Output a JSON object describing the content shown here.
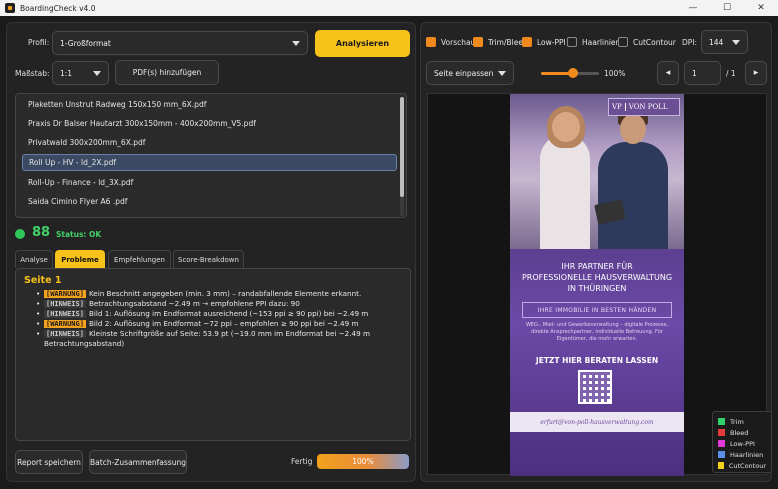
{
  "window": {
    "title": "BoardingCheck v4.0",
    "minimize": "—",
    "maximize": "☐",
    "close": "✕"
  },
  "left": {
    "profile_label": "Profil:",
    "profile_value": "1-Großformat",
    "analyze_label": "Analysieren",
    "scale_label": "Maßstab:",
    "scale_value": "1:1",
    "add_pdf_label": "PDF(s) hinzufügen",
    "files": [
      "Plaketten Unstrut Radweg 150x150 mm_6X.pdf",
      "Praxis Dr Balser Hautarzt 300x150mm - 400x200mm_V5.pdf",
      "Privatwald 300x200mm_6X.pdf",
      "Roll Up - HV - ld_2X.pdf",
      "Roll-Up - Finance - ld_3X.pdf",
      "Saida Cimino Flyer A6 .pdf"
    ],
    "selected_index": 3,
    "score": "88",
    "status": "Status: OK",
    "status_color": "#43d168",
    "tabs": [
      "Analyse",
      "Probleme",
      "Empfehlungen",
      "Score-Breakdown"
    ],
    "active_tab": "Probleme",
    "report": {
      "heading": "Seite 1",
      "issues": [
        {
          "tag": "[WARNUNG]",
          "type": "warn",
          "text": "Kein Beschnitt angegeben (min. 3 mm) – randabfallende Elemente erkannt."
        },
        {
          "tag": "[HINWEIS]",
          "type": "hint",
          "text": "Betrachtungsabstand ~2.49 m → empfohlene PPI dazu: 90"
        },
        {
          "tag": "[HINWEIS]",
          "type": "hint",
          "text": "Bild 1: Auflösung im Endformat ausreichend (~153 ppi ≥ 90 ppi) bei ~2.49 m"
        },
        {
          "tag": "[WARNUNG]",
          "type": "warn",
          "text": "Bild 2: Auflösung im Endformat ~72 ppi – empfohlen ≥ 90 ppi bei ~2.49 m"
        },
        {
          "tag": "[HINWEIS]",
          "type": "hint",
          "text": "Kleinste Schriftgröße auf Seite: 53.9 pt (~19.0 mm im Endformat bei ~2.49 m Betrachtungsabstand)"
        }
      ]
    },
    "report_save_label": "Report speichern",
    "batch_label": "Batch-Zusammenfassung",
    "progress_label": "Fertig",
    "progress_text": "100%",
    "progress_value": 1.0
  },
  "right": {
    "checkboxes": [
      {
        "label": "Vorschau",
        "checked": true
      },
      {
        "label": "Trim/Bleed",
        "checked": true
      },
      {
        "label": "Low-PPI",
        "checked": true
      },
      {
        "label": "Haarlinien",
        "checked": false
      },
      {
        "label": "CutContour",
        "checked": false
      }
    ],
    "dpi_label": "DPI:",
    "dpi_value": "144",
    "fit_value": "Seite einpassen",
    "zoom_text": "100%",
    "zoom_fraction": 0.55,
    "prev_icon": "◂",
    "next_icon": "▸",
    "page_value": "1",
    "page_total": "/ 1",
    "legend": [
      {
        "label": "Trim",
        "color": "#2fd06a"
      },
      {
        "label": "Bleed",
        "color": "#e43b3b"
      },
      {
        "label": "Low-PPI",
        "color": "#e03ad6"
      },
      {
        "label": "Haarlinien",
        "color": "#5b8ee8"
      },
      {
        "label": "CutContour",
        "color": "#f0d21c"
      }
    ]
  },
  "flyer": {
    "logo_mark": "VP",
    "logo_name": "VON POLL",
    "h1": "IHR PARTNER FÜR",
    "h2": "PROFESSIONELLE HAUSVERWALTUNG",
    "h3": "IN THÜRINGEN",
    "box": "IHRE IMMOBILIE IN BESTEN HÄNDEN",
    "small": "WEG-, Miet- und Gewerbeverwaltung – digitale Prozesse, direkte Ansprechpartner, individuelle Betreuung. Für Eigentümer, die mehr erwarten.",
    "cta": "JETZT HIER BERATEN LASSEN",
    "footer": "erfurt@von-poll-hausverwaltung.com"
  }
}
